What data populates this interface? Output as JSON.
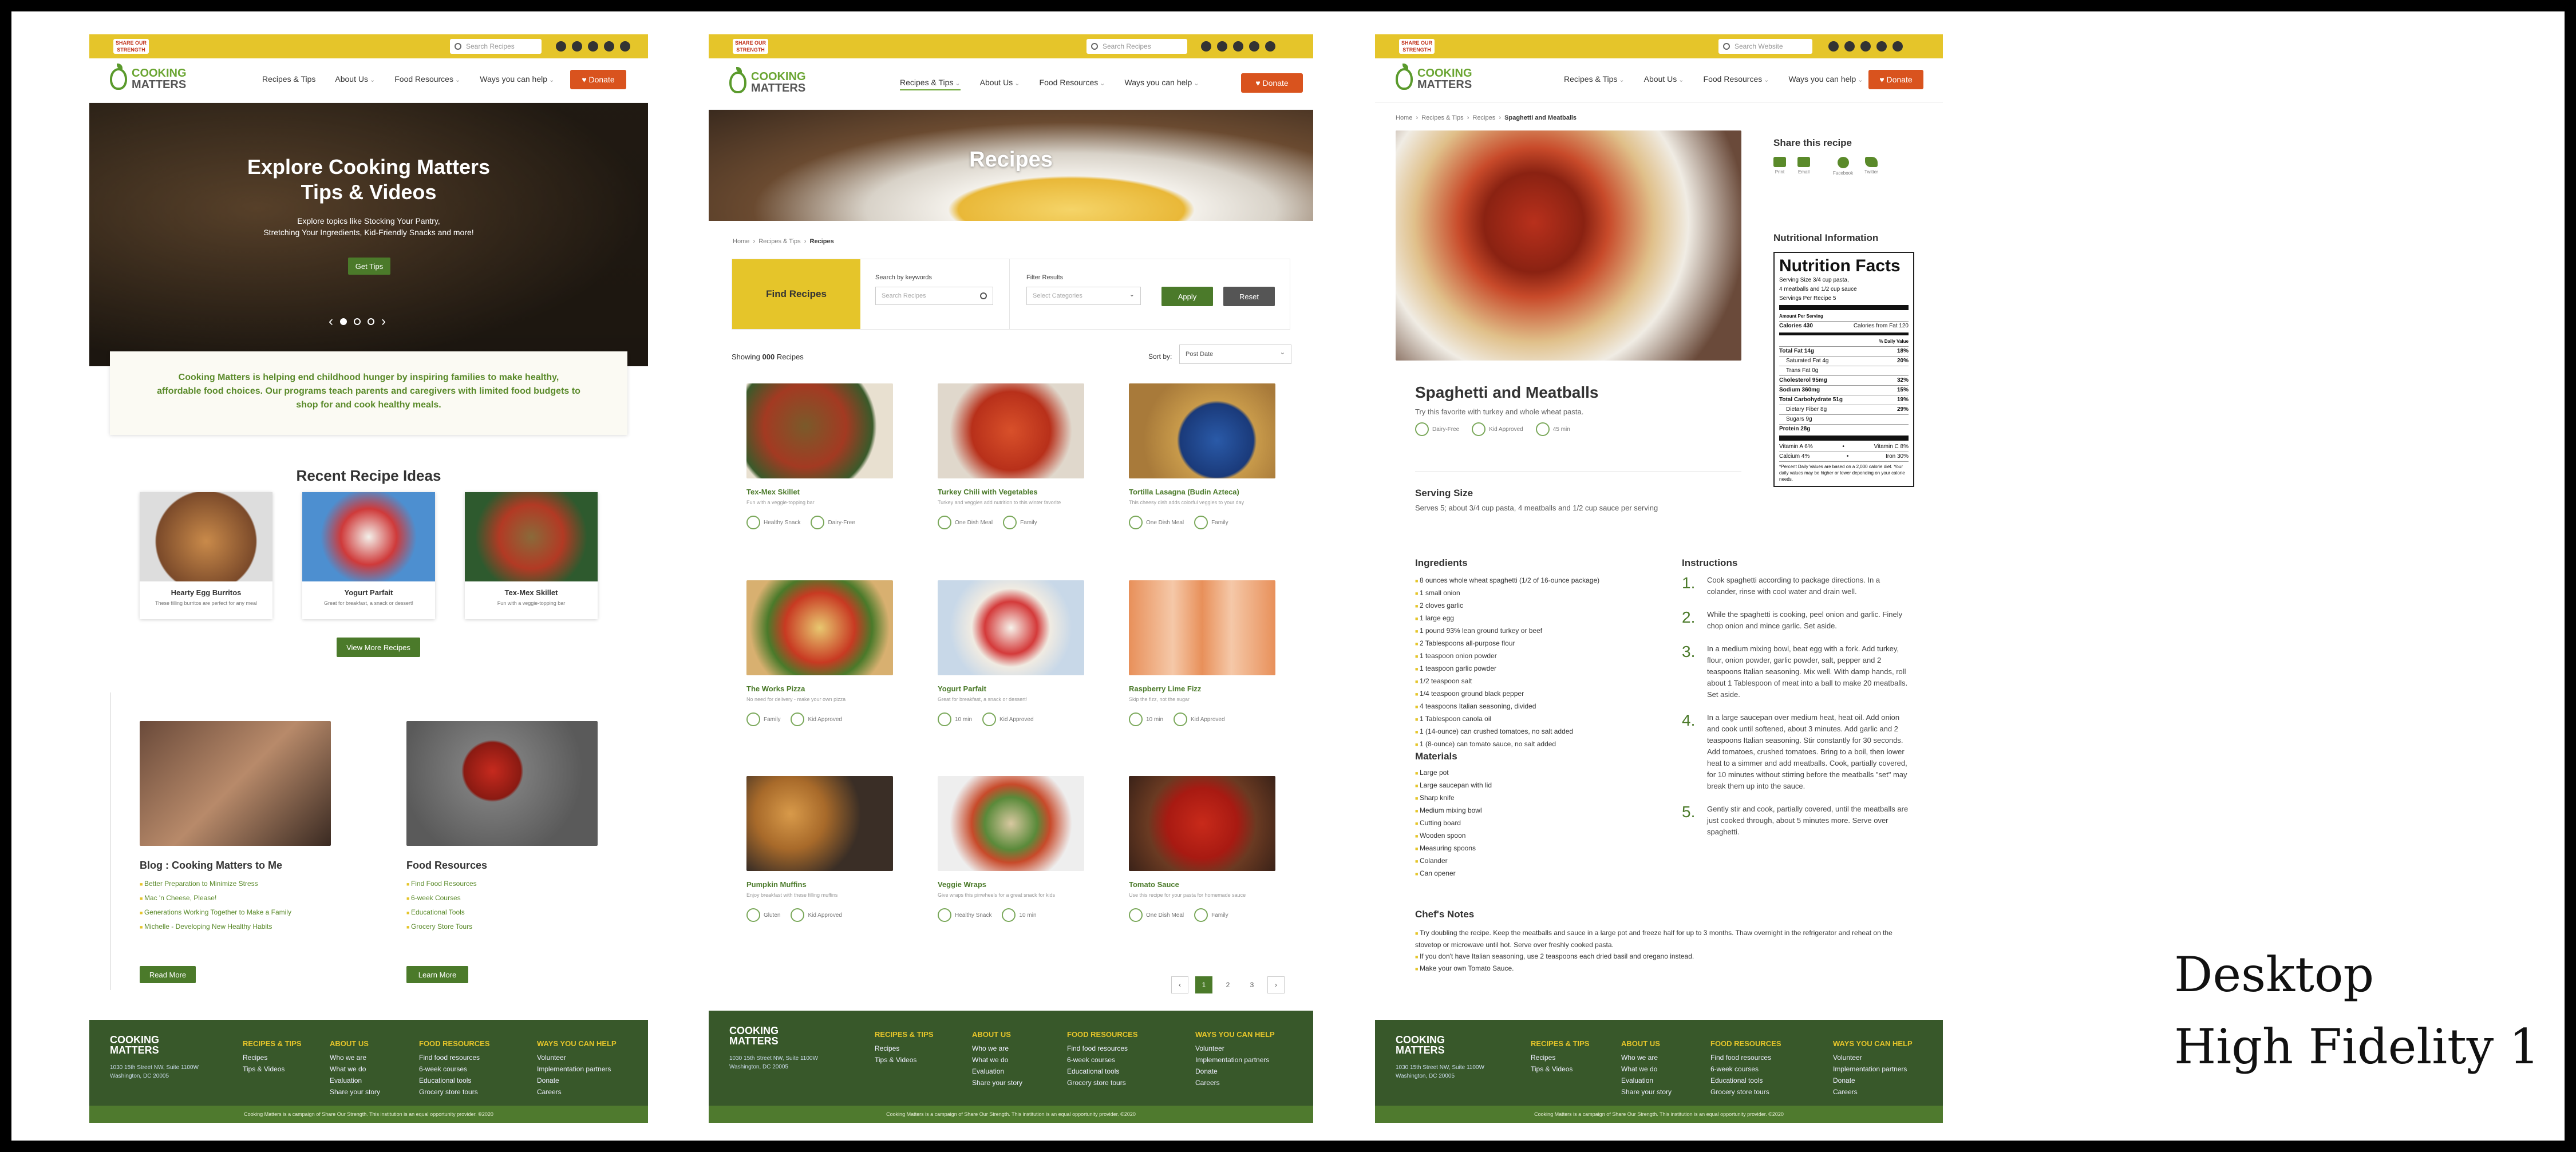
{
  "caption": {
    "line1": "Desktop",
    "line2": "High Fidelity 1"
  },
  "header": {
    "logo_small": "SHARE OUR STRENGTH",
    "brand_top": "COOKING",
    "brand_bottom": "MATTERS",
    "search_placeholder": "Search Recipes",
    "search_placeholder_alt": "Search Website",
    "menu": [
      "Recipes & Tips",
      "About Us",
      "Food Resources",
      "Ways you can help"
    ],
    "donate": "Donate"
  },
  "page1": {
    "hero": {
      "title_l1": "Explore Cooking Matters",
      "title_l2": "Tips & Videos",
      "sub_l1": "Explore topics like Stocking Your Pantry,",
      "sub_l2": "Stretching Your Ingredients, Kid-Friendly Snacks and more!",
      "button": "Get Tips"
    },
    "mission": "Cooking Matters is helping end childhood hunger by inspiring families to make healthy, affordable food choices. Our programs teach parents and caregivers with limited food budgets to shop for and cook healthy meals.",
    "recent_title": "Recent Recipe Ideas",
    "cards": [
      {
        "title": "Hearty Egg Burritos",
        "desc": "These filling burritos are perfect for any meal"
      },
      {
        "title": "Yogurt Parfait",
        "desc": "Great for breakfast, a snack or dessert!"
      },
      {
        "title": "Tex-Mex Skillet",
        "desc": "Fun with a veggie-topping bar"
      }
    ],
    "more_btn": "View More Recipes",
    "blog": {
      "title": "Blog : Cooking Matters to Me",
      "items": [
        "Better Preparation to Minimize Stress",
        "Mac 'n Cheese, Please!",
        "Generations Working Together to Make a Family",
        "Michelle - Developing New Healthy Habits"
      ],
      "button": "Read More"
    },
    "food": {
      "title": "Food Resources",
      "items": [
        "Find Food Resources",
        "6-week Courses",
        "Educational Tools",
        "Grocery Store Tours"
      ],
      "button": "Learn More"
    }
  },
  "page2": {
    "banner": "Recipes",
    "breadcrumb": [
      "Home",
      "Recipes & Tips",
      "Recipes"
    ],
    "find": {
      "label": "Find Recipes",
      "kw_label": "Search by keywords",
      "kw_placeholder": "Search Recipes",
      "filter_label": "Filter Results",
      "filter_placeholder": "Select Categories",
      "apply": "Apply",
      "reset": "Reset"
    },
    "showing_prefix": "Showing",
    "showing_count": "000",
    "showing_suffix": "Recipes",
    "sort_label": "Sort by:",
    "sort_value": "Post Date",
    "recipes": [
      {
        "title": "Tex-Mex Skillet",
        "desc": "Fun with a veggie-topping bar",
        "tags": [
          "Healthy Snack",
          "Dairy-Free"
        ]
      },
      {
        "title": "Turkey Chili with Vegetables",
        "desc": "Turkey and veggies add nutrition to this winter favorite",
        "tags": [
          "One Dish Meal",
          "Family"
        ]
      },
      {
        "title": "Tortilla Lasagna (Budin Azteca)",
        "desc": "This cheesy dish adds colorful veggies to your day",
        "tags": [
          "One Dish Meal",
          "Family"
        ]
      },
      {
        "title": "The Works Pizza",
        "desc": "No need for delivery - make your own pizza",
        "tags": [
          "Family",
          "Kid Approved"
        ]
      },
      {
        "title": "Yogurt Parfait",
        "desc": "Great for breakfast, a snack or dessert!",
        "tags": [
          "10 min",
          "Kid Approved"
        ]
      },
      {
        "title": "Raspberry Lime Fizz",
        "desc": "Skip the fizz, not the sugar",
        "tags": [
          "10 min",
          "Kid Approved"
        ]
      },
      {
        "title": "Pumpkin Muffins",
        "desc": "Enjoy breakfast with these filling muffins",
        "tags": [
          "Gluten",
          "Kid Approved"
        ]
      },
      {
        "title": "Veggie Wraps",
        "desc": "Give wraps this pinwheels for a great snack for kids",
        "tags": [
          "Healthy Snack",
          "10 min"
        ]
      },
      {
        "title": "Tomato Sauce",
        "desc": "Use this recipe for your pasta for homemade sauce",
        "tags": [
          "One Dish Meal",
          "Family"
        ]
      }
    ],
    "pages": [
      "1",
      "2",
      "3"
    ]
  },
  "page3": {
    "breadcrumb": [
      "Home",
      "Recipes & Tips",
      "Recipes",
      "Spaghetti and Meatballs"
    ],
    "title": "Spaghetti and Meatballs",
    "subtitle": "Try this favorite with turkey and whole wheat pasta.",
    "tags": [
      "Dairy-Free",
      "Kid Approved",
      "45 min"
    ],
    "share_title": "Share this recipe",
    "share": [
      "Print",
      "Email",
      "Facebook",
      "Twitter"
    ],
    "nutrition_title": "Nutritional Information",
    "nf": {
      "head": "Nutrition Facts",
      "serving_l1": "Serving Size 3/4 cup pasta,",
      "serving_l2": "4 meatballs and 1/2 cup sauce",
      "servings": "Servings Per Recipe 5",
      "aps": "Amount Per Serving",
      "calories": "Calories 430",
      "cal_fat": "Calories from Fat 120",
      "dv": "% Daily Value",
      "rows": [
        [
          "Total Fat 14g",
          "18%"
        ],
        [
          "Saturated Fat 4g",
          "20%"
        ],
        [
          "Trans Fat 0g",
          ""
        ],
        [
          "Cholesterol 95mg",
          "32%"
        ],
        [
          "Sodium 360mg",
          "15%"
        ],
        [
          "Total Carbohydrate 51g",
          "19%"
        ],
        [
          "Dietary Fiber 8g",
          "29%"
        ],
        [
          "Sugars 9g",
          ""
        ],
        [
          "Protein 28g",
          ""
        ]
      ],
      "vit_a": "Vitamin A 6%",
      "vit_c": "Vitamin C 8%",
      "calcium": "Calcium 4%",
      "iron": "Iron 30%",
      "note": "*Percent Daily Values are based on a 2,000 calorie diet. Your daily values may be higher or lower depending on your calorie needs."
    },
    "serving_title": "Serving Size",
    "serving_text": "Serves 5; about 3/4 cup pasta, 4 meatballs and 1/2 cup sauce per serving",
    "ingredients_title": "Ingredients",
    "ingredients": [
      "8 ounces whole wheat spaghetti (1/2 of 16-ounce package)",
      "1 small onion",
      "2 cloves garlic",
      "1 large egg",
      "1 pound 93% lean ground turkey or beef",
      "2 Tablespoons all-purpose flour",
      "1 teaspoon onion powder",
      "1 teaspoon garlic powder",
      "1/2 teaspoon salt",
      "1/4 teaspoon ground black pepper",
      "4 teaspoons Italian seasoning, divided",
      "1 Tablespoon canola oil",
      "1 (14-ounce) can crushed tomatoes, no salt added",
      "1 (8-ounce) can tomato sauce, no salt added"
    ],
    "materials_title": "Materials",
    "materials": [
      "Large pot",
      "Large saucepan with lid",
      "Sharp knife",
      "Medium mixing bowl",
      "Cutting board",
      "Wooden spoon",
      "Measuring spoons",
      "Colander",
      "Can opener"
    ],
    "instructions_title": "Instructions",
    "steps": [
      "Cook spaghetti according to package directions. In a colander, rinse with cool water and drain well.",
      "While the spaghetti is cooking, peel onion and garlic. Finely chop onion and mince garlic. Set aside.",
      "In a medium mixing bowl, beat egg with a fork. Add turkey, flour, onion powder, garlic powder, salt, pepper and 2 teaspoons Italian seasoning. Mix well. With damp hands, roll about 1 Tablespoon of meat into a ball to make 20 meatballs. Set aside.",
      "In a large saucepan over medium heat, heat oil. Add onion and cook until softened, about 3 minutes. Add garlic and 2 teaspoons Italian seasoning. Stir constantly for 30 seconds. Add tomatoes, crushed tomatoes. Bring to a boil, then lower heat to a simmer and add meatballs. Cook, partially covered, for 10 minutes without stirring before the meatballs \"set\" may break them up into the sauce.",
      "Gently stir and cook, partially covered, until the meatballs are just cooked through, about 5 minutes more. Serve over spaghetti."
    ],
    "chef_title": "Chef's Notes",
    "chef": [
      "Try doubling the recipe. Keep the meatballs and sauce in a large pot and freeze half for up to 3 months. Thaw overnight in the refrigerator and reheat on the stovetop or microwave until hot. Serve over freshly cooked pasta.",
      "If you don't have Italian seasoning, use 2 teaspoons each dried basil and oregano instead.",
      "Make your own Tomato Sauce."
    ]
  },
  "footer": {
    "address_l1": "1030 15th Street NW, Suite 1100W",
    "address_l2": "Washington, DC 20005",
    "cols": [
      {
        "title": "RECIPES & TIPS",
        "items": [
          "Recipes",
          "Tips & Videos"
        ]
      },
      {
        "title": "ABOUT US",
        "items": [
          "Who we are",
          "What we do",
          "Evaluation",
          "Share your story"
        ]
      },
      {
        "title": "FOOD RESOURCES",
        "items": [
          "Find food resources",
          "6-week courses",
          "Educational tools",
          "Grocery store tours"
        ]
      },
      {
        "title": "WAYS YOU CAN HELP",
        "items": [
          "Volunteer",
          "Implementation partners",
          "Donate",
          "Careers"
        ]
      }
    ],
    "copyright": "Cooking Matters is a campaign of Share Our Strength. This institution is an equal opportunity provider. ©2020"
  }
}
